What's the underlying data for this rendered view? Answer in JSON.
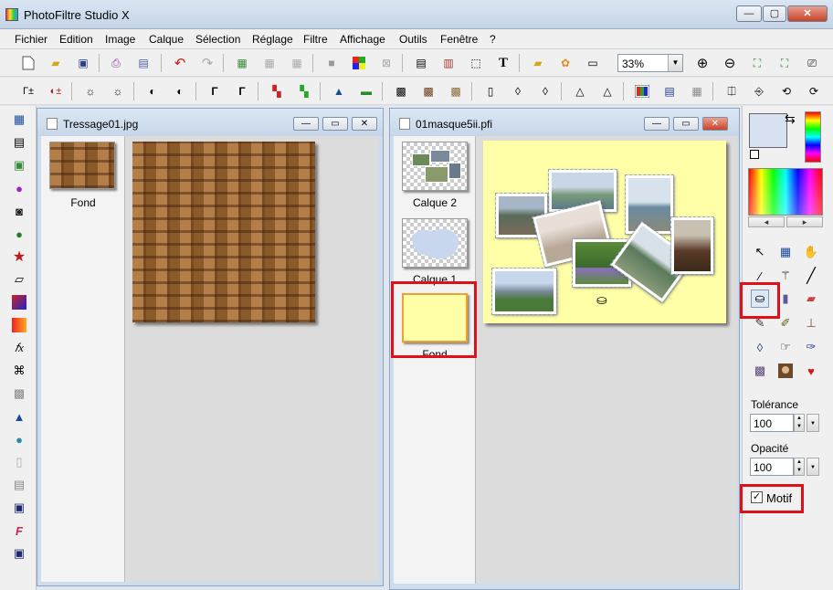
{
  "window": {
    "title": "PhotoFiltre Studio X",
    "btn_min": "—",
    "btn_max": "▢",
    "btn_close": "✕"
  },
  "menu": [
    "Fichier",
    "Edition",
    "Image",
    "Calque",
    "Sélection",
    "Réglage",
    "Filtre",
    "Affichage",
    "Outils",
    "Fenêtre",
    "?"
  ],
  "toolbar": {
    "zoom_value": "33%"
  },
  "doc1": {
    "title": "Tressage01.jpg",
    "layers": [
      {
        "label": "Fond"
      }
    ]
  },
  "doc2": {
    "title": "01masque5ii.pfi",
    "layers": [
      {
        "label": "Calque 2"
      },
      {
        "label": "Calque 1"
      },
      {
        "label": "Fond"
      }
    ]
  },
  "tools": {
    "tolerance_label": "Tolérance",
    "tolerance_value": "100",
    "opacity_label": "Opacité",
    "opacity_value": "100",
    "motif_label": "Motif",
    "motif_checked": "✓"
  },
  "colors": {
    "foreground": "#d7e1f1",
    "background": "#ffffff",
    "canvas_fill": "#ffffa8",
    "highlight": "#e0101a"
  },
  "palette_arrows": {
    "left": "◂",
    "right": "▸"
  }
}
